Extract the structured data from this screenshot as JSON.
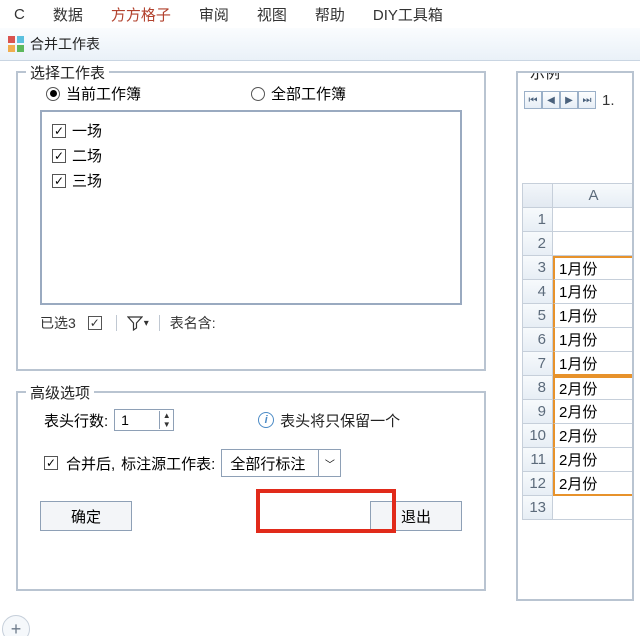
{
  "menu": {
    "items": [
      "C",
      "数据",
      "方方格子",
      "审阅",
      "视图",
      "帮助",
      "DIY工具箱"
    ],
    "active_index": 2
  },
  "window": {
    "title": "合并工作表"
  },
  "select_panel": {
    "legend": "选择工作表",
    "radio_current": "当前工作簿",
    "radio_all": "全部工作簿",
    "radio_checked": "current",
    "items": [
      {
        "label": "一场",
        "checked": true
      },
      {
        "label": "二场",
        "checked": true
      },
      {
        "label": "三场",
        "checked": true
      }
    ],
    "status_count_label": "已选3",
    "table_alias_label": "表名含:"
  },
  "advanced_panel": {
    "legend": "高级选项",
    "header_rows_label": "表头行数:",
    "header_rows_value": "1",
    "header_hint": "表头将只保留一个",
    "merge_checked": true,
    "merge_label": "合并后,",
    "annotate_label": "标注源工作表:",
    "annotate_value": "全部行标注",
    "btn_ok": "确定",
    "btn_exit": "退出"
  },
  "example_panel": {
    "legend": "示例",
    "nav_label": "1.",
    "columns": [
      "A"
    ],
    "rows": [
      {
        "n": "1",
        "a": ""
      },
      {
        "n": "2",
        "a": ""
      },
      {
        "n": "3",
        "a": "1月份"
      },
      {
        "n": "4",
        "a": "1月份"
      },
      {
        "n": "5",
        "a": "1月份"
      },
      {
        "n": "6",
        "a": "1月份"
      },
      {
        "n": "7",
        "a": "1月份"
      },
      {
        "n": "8",
        "a": "2月份"
      },
      {
        "n": "9",
        "a": "2月份"
      },
      {
        "n": "10",
        "a": "2月份"
      },
      {
        "n": "11",
        "a": "2月份"
      },
      {
        "n": "12",
        "a": "2月份"
      },
      {
        "n": "13",
        "a": ""
      }
    ]
  }
}
